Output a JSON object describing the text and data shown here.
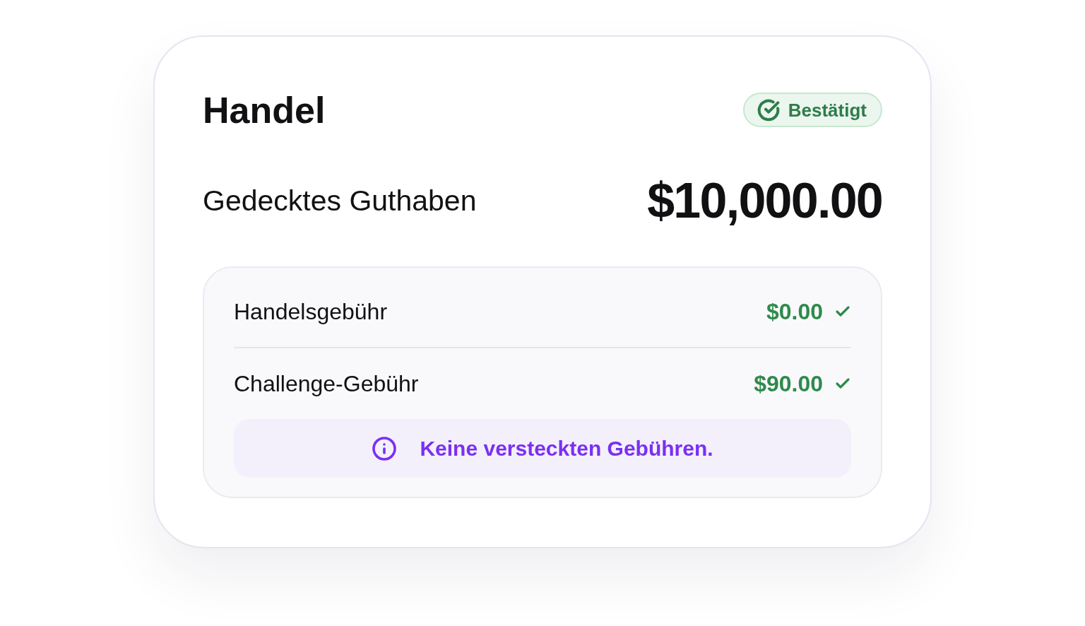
{
  "card": {
    "title": "Handel",
    "status_badge": {
      "label": "Bestätigt"
    },
    "balance": {
      "label": "Gedecktes Guthaben",
      "amount": "$10,000.00"
    },
    "fees": [
      {
        "label": "Handelsgebühr",
        "amount": "$0.00",
        "checked": true
      },
      {
        "label": "Challenge-Gebühr",
        "amount": "$90.00",
        "checked": true
      }
    ],
    "notice": {
      "text": "Keine versteckten Gebühren."
    }
  }
}
